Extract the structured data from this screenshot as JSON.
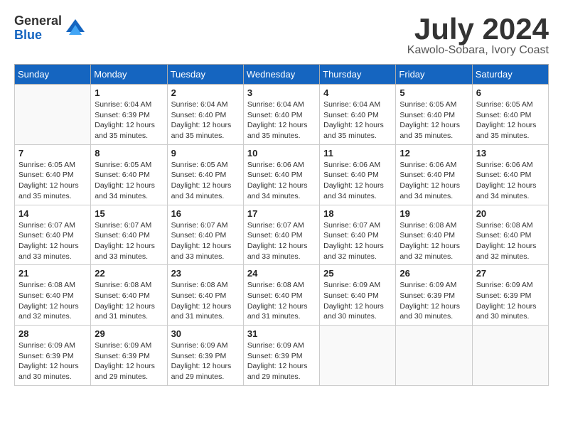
{
  "header": {
    "logo_general": "General",
    "logo_blue": "Blue",
    "month_title": "July 2024",
    "subtitle": "Kawolo-Sobara, Ivory Coast"
  },
  "days_of_week": [
    "Sunday",
    "Monday",
    "Tuesday",
    "Wednesday",
    "Thursday",
    "Friday",
    "Saturday"
  ],
  "weeks": [
    [
      {
        "day": "",
        "info": ""
      },
      {
        "day": "1",
        "info": "Sunrise: 6:04 AM\nSunset: 6:39 PM\nDaylight: 12 hours\nand 35 minutes."
      },
      {
        "day": "2",
        "info": "Sunrise: 6:04 AM\nSunset: 6:40 PM\nDaylight: 12 hours\nand 35 minutes."
      },
      {
        "day": "3",
        "info": "Sunrise: 6:04 AM\nSunset: 6:40 PM\nDaylight: 12 hours\nand 35 minutes."
      },
      {
        "day": "4",
        "info": "Sunrise: 6:04 AM\nSunset: 6:40 PM\nDaylight: 12 hours\nand 35 minutes."
      },
      {
        "day": "5",
        "info": "Sunrise: 6:05 AM\nSunset: 6:40 PM\nDaylight: 12 hours\nand 35 minutes."
      },
      {
        "day": "6",
        "info": "Sunrise: 6:05 AM\nSunset: 6:40 PM\nDaylight: 12 hours\nand 35 minutes."
      }
    ],
    [
      {
        "day": "7",
        "info": "Sunrise: 6:05 AM\nSunset: 6:40 PM\nDaylight: 12 hours\nand 35 minutes."
      },
      {
        "day": "8",
        "info": "Sunrise: 6:05 AM\nSunset: 6:40 PM\nDaylight: 12 hours\nand 34 minutes."
      },
      {
        "day": "9",
        "info": "Sunrise: 6:05 AM\nSunset: 6:40 PM\nDaylight: 12 hours\nand 34 minutes."
      },
      {
        "day": "10",
        "info": "Sunrise: 6:06 AM\nSunset: 6:40 PM\nDaylight: 12 hours\nand 34 minutes."
      },
      {
        "day": "11",
        "info": "Sunrise: 6:06 AM\nSunset: 6:40 PM\nDaylight: 12 hours\nand 34 minutes."
      },
      {
        "day": "12",
        "info": "Sunrise: 6:06 AM\nSunset: 6:40 PM\nDaylight: 12 hours\nand 34 minutes."
      },
      {
        "day": "13",
        "info": "Sunrise: 6:06 AM\nSunset: 6:40 PM\nDaylight: 12 hours\nand 34 minutes."
      }
    ],
    [
      {
        "day": "14",
        "info": "Sunrise: 6:07 AM\nSunset: 6:40 PM\nDaylight: 12 hours\nand 33 minutes."
      },
      {
        "day": "15",
        "info": "Sunrise: 6:07 AM\nSunset: 6:40 PM\nDaylight: 12 hours\nand 33 minutes."
      },
      {
        "day": "16",
        "info": "Sunrise: 6:07 AM\nSunset: 6:40 PM\nDaylight: 12 hours\nand 33 minutes."
      },
      {
        "day": "17",
        "info": "Sunrise: 6:07 AM\nSunset: 6:40 PM\nDaylight: 12 hours\nand 33 minutes."
      },
      {
        "day": "18",
        "info": "Sunrise: 6:07 AM\nSunset: 6:40 PM\nDaylight: 12 hours\nand 32 minutes."
      },
      {
        "day": "19",
        "info": "Sunrise: 6:08 AM\nSunset: 6:40 PM\nDaylight: 12 hours\nand 32 minutes."
      },
      {
        "day": "20",
        "info": "Sunrise: 6:08 AM\nSunset: 6:40 PM\nDaylight: 12 hours\nand 32 minutes."
      }
    ],
    [
      {
        "day": "21",
        "info": "Sunrise: 6:08 AM\nSunset: 6:40 PM\nDaylight: 12 hours\nand 32 minutes."
      },
      {
        "day": "22",
        "info": "Sunrise: 6:08 AM\nSunset: 6:40 PM\nDaylight: 12 hours\nand 31 minutes."
      },
      {
        "day": "23",
        "info": "Sunrise: 6:08 AM\nSunset: 6:40 PM\nDaylight: 12 hours\nand 31 minutes."
      },
      {
        "day": "24",
        "info": "Sunrise: 6:08 AM\nSunset: 6:40 PM\nDaylight: 12 hours\nand 31 minutes."
      },
      {
        "day": "25",
        "info": "Sunrise: 6:09 AM\nSunset: 6:40 PM\nDaylight: 12 hours\nand 30 minutes."
      },
      {
        "day": "26",
        "info": "Sunrise: 6:09 AM\nSunset: 6:39 PM\nDaylight: 12 hours\nand 30 minutes."
      },
      {
        "day": "27",
        "info": "Sunrise: 6:09 AM\nSunset: 6:39 PM\nDaylight: 12 hours\nand 30 minutes."
      }
    ],
    [
      {
        "day": "28",
        "info": "Sunrise: 6:09 AM\nSunset: 6:39 PM\nDaylight: 12 hours\nand 30 minutes."
      },
      {
        "day": "29",
        "info": "Sunrise: 6:09 AM\nSunset: 6:39 PM\nDaylight: 12 hours\nand 29 minutes."
      },
      {
        "day": "30",
        "info": "Sunrise: 6:09 AM\nSunset: 6:39 PM\nDaylight: 12 hours\nand 29 minutes."
      },
      {
        "day": "31",
        "info": "Sunrise: 6:09 AM\nSunset: 6:39 PM\nDaylight: 12 hours\nand 29 minutes."
      },
      {
        "day": "",
        "info": ""
      },
      {
        "day": "",
        "info": ""
      },
      {
        "day": "",
        "info": ""
      }
    ]
  ]
}
